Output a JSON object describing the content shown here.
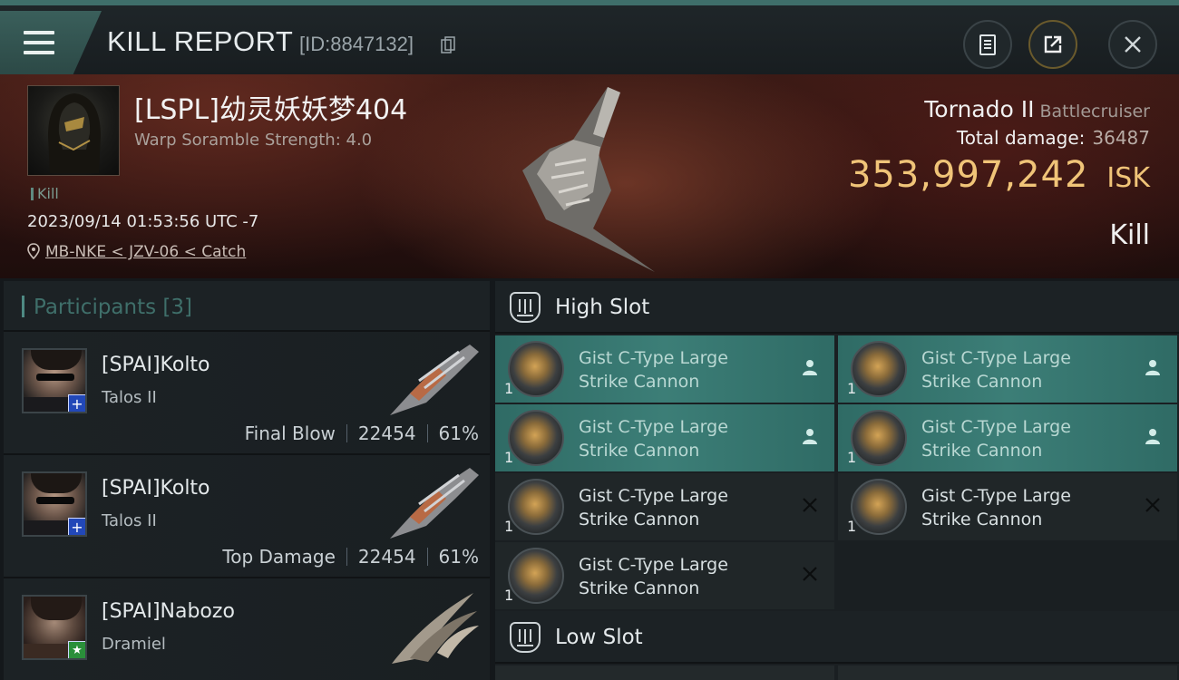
{
  "header": {
    "title": "KILL REPORT",
    "report_id": "[ID:8847132]"
  },
  "victim": {
    "name": "[LSPL]幼灵妖妖梦404",
    "subtitle": "Warp Soramble Strength: 4.0",
    "tag": "Kill",
    "time": "2023/09/14 01:53:56 UTC -7",
    "location": "MB-NKE < JZV-06 < Catch",
    "ship_name": "Tornado II",
    "ship_class": "Battlecruiser",
    "total_damage_label": "Total damage:",
    "total_damage": "36487",
    "isk_value": "353,997,242",
    "isk_unit": "ISK",
    "result": "Kill"
  },
  "participants": {
    "label": "Participants [3]",
    "items": [
      {
        "name": "[SPAI]Kolto",
        "ship": "Talos II",
        "role": "Final Blow",
        "damage": "22454",
        "percent": "61%",
        "badge": "+",
        "badge_color": "#2248b8"
      },
      {
        "name": "[SPAI]Kolto",
        "ship": "Talos II",
        "role": "Top Damage",
        "damage": "22454",
        "percent": "61%",
        "badge": "+",
        "badge_color": "#2248b8"
      },
      {
        "name": "[SPAI]Nabozo",
        "ship": "Dramiel",
        "role": "",
        "damage": "",
        "percent": "",
        "badge": "★",
        "badge_color": "#2a8f3a"
      }
    ]
  },
  "slots": {
    "high_label": "High Slot",
    "low_label": "Low Slot",
    "high_modules": [
      {
        "line1": "Gist C-Type Large",
        "line2": "Strike Cannon",
        "qty": "1",
        "state": "fitted"
      },
      {
        "line1": "Gist C-Type Large",
        "line2": "Strike Cannon",
        "qty": "1",
        "state": "fitted"
      },
      {
        "line1": "Gist C-Type Large",
        "line2": "Strike Cannon",
        "qty": "1",
        "state": "fitted"
      },
      {
        "line1": "Gist C-Type Large",
        "line2": "Strike Cannon",
        "qty": "1",
        "state": "fitted"
      },
      {
        "line1": "Gist C-Type Large",
        "line2": "Strike Cannon",
        "qty": "1",
        "state": "destroyed"
      },
      {
        "line1": "Gist C-Type Large",
        "line2": "Strike Cannon",
        "qty": "1",
        "state": "destroyed"
      },
      {
        "line1": "Gist C-Type Large",
        "line2": "Strike Cannon",
        "qty": "1",
        "state": "destroyed"
      }
    ]
  },
  "colors": {
    "accent_teal": "#3c7e77",
    "isk_gold": "#f0c478"
  },
  "icons": {
    "menu": "menu-icon",
    "copy": "copy-icon",
    "clipboard": "clipboard-icon",
    "share": "share-icon",
    "close": "close-icon",
    "pin": "location-pin-icon",
    "fitted": "pilot-icon",
    "destroyed": "x-icon"
  }
}
